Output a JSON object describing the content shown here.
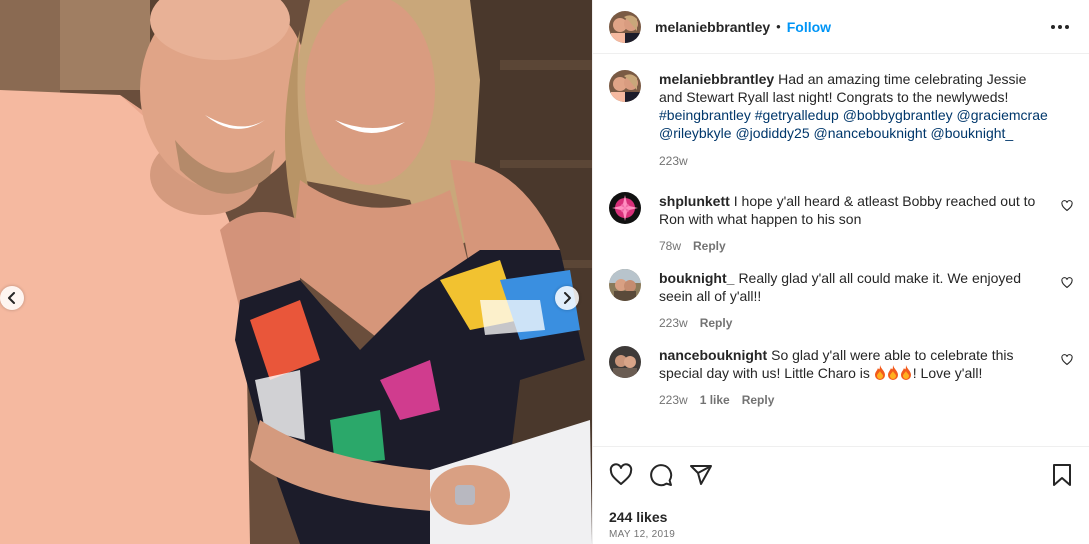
{
  "post": {
    "author": "melaniebbrantley",
    "separator": "•",
    "follow_label": "Follow",
    "caption_text": "Had an amazing time celebrating Jessie and Stewart Ryall last night! Congrats to the newlyweds!",
    "caption_tags": [
      "#beingbrantley",
      "#getryalledup",
      "@bobbygbrantley",
      "@graciemcrae",
      "@rileybkyle",
      "@jodiddy25",
      "@nancebouknight",
      "@bouknight_"
    ],
    "caption_time": "223w",
    "likes": "244 likes",
    "date": "MAY 12, 2019"
  },
  "comments": [
    {
      "username": "shplunkett",
      "text": "I hope y'all heard & atleast Bobby reached out to Ron with what happen to his son",
      "time": "78w",
      "likes": "",
      "reply": "Reply"
    },
    {
      "username": "bouknight_",
      "text": "Really glad y'all all could make it. We enjoyed seein all of y'all!!",
      "time": "223w",
      "likes": "",
      "reply": "Reply"
    },
    {
      "username": "nancebouknight",
      "text_before": "So glad y'all were able to celebrate this special day with us! Little Charo is ",
      "text_after": "! Love y'all!",
      "time": "223w",
      "likes": "1 like",
      "reply": "Reply"
    }
  ],
  "icons": {
    "more": "more-options-icon",
    "like": "heart-icon",
    "comment": "comment-icon",
    "share": "share-icon",
    "save": "bookmark-icon",
    "prev": "chevron-left-icon",
    "next": "chevron-right-icon"
  },
  "colors": {
    "link": "#0095f6",
    "tag": "#00376b",
    "muted": "#737373"
  }
}
